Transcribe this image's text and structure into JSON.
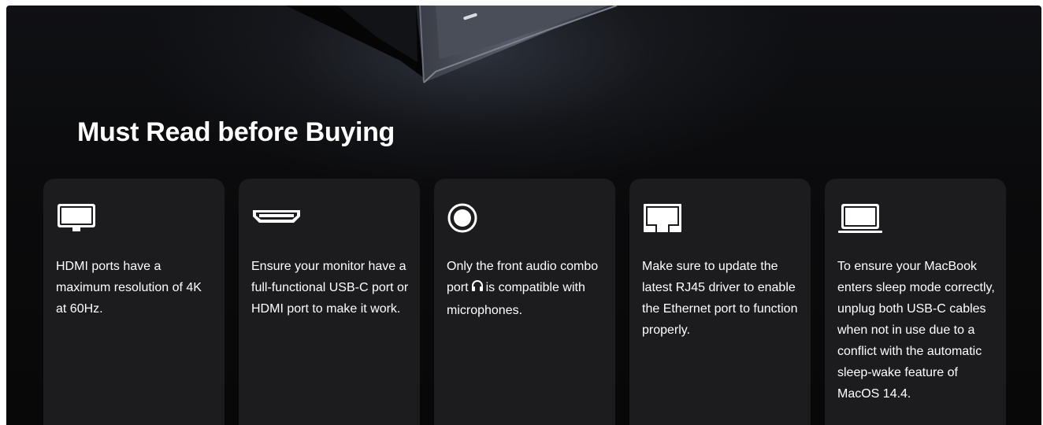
{
  "section": {
    "title": "Must Read before Buying"
  },
  "cards": [
    {
      "icon": "monitor-icon",
      "text": "HDMI ports have a maximum resolution of 4K at 60Hz."
    },
    {
      "icon": "hdmi-port-icon",
      "text": "Ensure your monitor have a full-functional USB-C port or HDMI port to make it work."
    },
    {
      "icon": "audio-jack-icon",
      "text_before": "Only the front audio combo port",
      "inline_icon": "headphones-icon",
      "text_after": "is compatible with microphones."
    },
    {
      "icon": "ethernet-port-icon",
      "text": "Make sure to update the latest RJ45 driver to enable the Ethernet port to function properly."
    },
    {
      "icon": "laptop-icon",
      "text": "To ensure your MacBook enters sleep mode correctly, unplug both USB-C cables when not in use due to a conflict with the automatic sleep-wake feature of MacOS 14.4."
    }
  ],
  "colors": {
    "background": "#0b0b0d",
    "card": "#1c1c1e",
    "text": "#ffffff"
  }
}
